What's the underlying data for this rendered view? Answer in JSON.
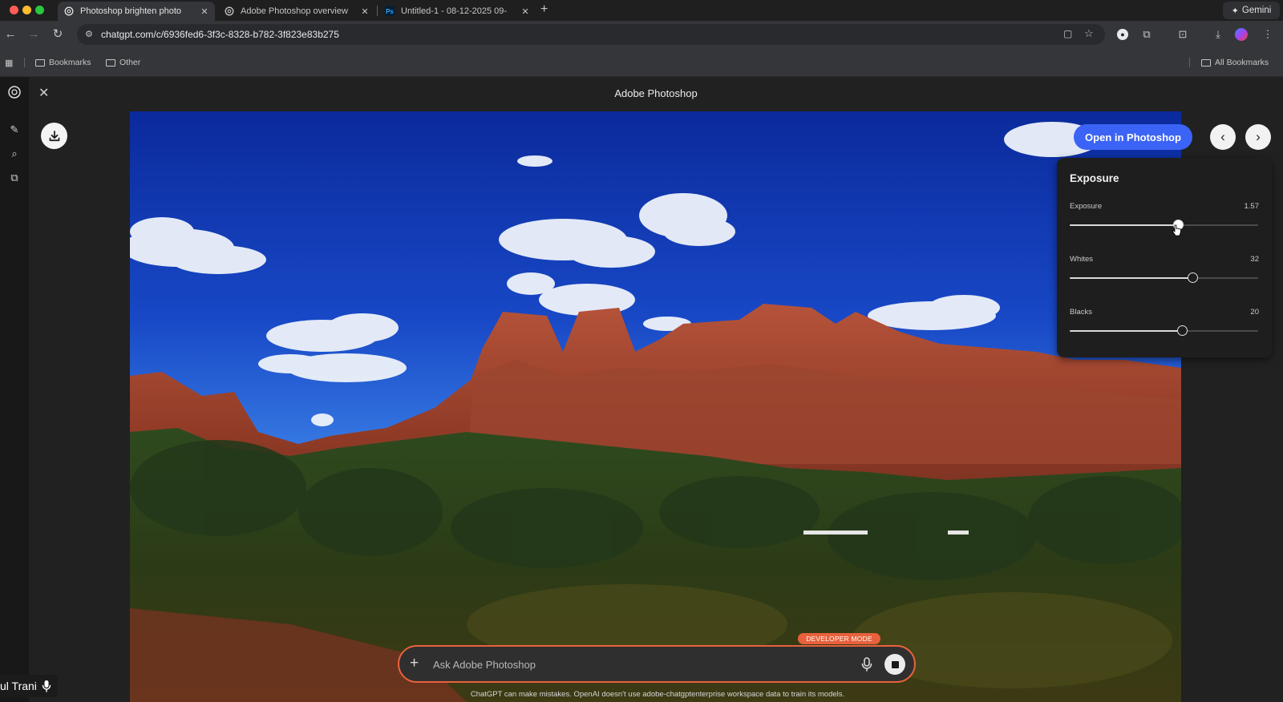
{
  "browser": {
    "tabs": [
      {
        "title": "Photoshop brighten photo",
        "icon": "chatgpt-icon",
        "active": true
      },
      {
        "title": "Adobe Photoshop overview",
        "icon": "chatgpt-icon",
        "active": false
      },
      {
        "title": "Untitled-1 - 08-12-2025 09-",
        "icon": "photoshop-icon",
        "active": false
      }
    ],
    "gemini_label": "Gemini",
    "url": "chatgpt.com/c/6936fed6-3f3c-8328-b782-3f823e83b275",
    "bookmarks": [
      "Bookmarks",
      "Other"
    ],
    "all_bookmarks": "All Bookmarks"
  },
  "app": {
    "title": "Adobe Photoshop",
    "open_button": "Open in Photoshop"
  },
  "panel": {
    "title": "Exposure",
    "sliders": [
      {
        "label": "Exposure",
        "value": "1.57",
        "fraction": 0.575
      },
      {
        "label": "Whites",
        "value": "32",
        "fraction": 0.65
      },
      {
        "label": "Blacks",
        "value": "20",
        "fraction": 0.595
      }
    ]
  },
  "composer": {
    "badge": "DEVELOPER MODE",
    "placeholder": "Ask Adobe Photoshop",
    "disclaimer": "ChatGPT can make mistakes. OpenAI doesn't use adobe-chatgptenterprise workspace data to train its models."
  },
  "caption": {
    "text": "ul Trani"
  },
  "colors": {
    "accent_blue": "#3b63f5",
    "developer_orange": "#e8613c"
  }
}
